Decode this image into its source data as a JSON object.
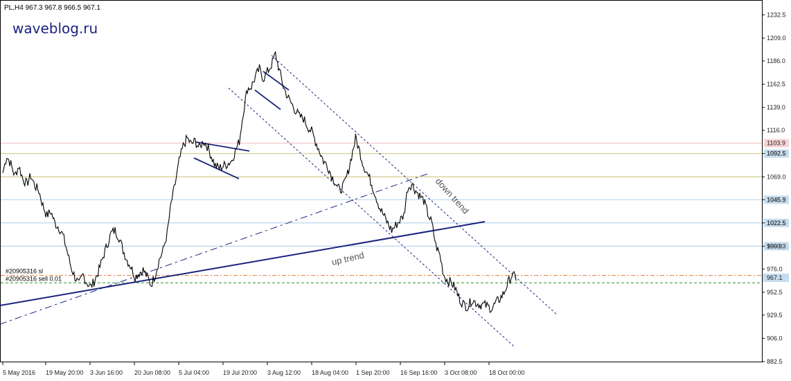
{
  "header": {
    "symbol_line": "PL,H4  967.3 967.8 966.5 967.1",
    "brand": "waveblog.ru"
  },
  "colors": {
    "price": "#000000",
    "trendline": "#1a237e",
    "level_blue": "#b8d6ee",
    "level_olive": "#d2cc8c",
    "level_pink": "#f4c9c9",
    "sl_line": "#e8742a",
    "sell_line": "#2a8a2a",
    "axis_bg_blue": "#c6dcef"
  },
  "chart_data": {
    "type": "line",
    "title": "",
    "ylim": [
      882.5,
      1244
    ],
    "y_ticks": [
      "1232.5",
      "1209.0",
      "1186.0",
      "1162.5",
      "1139.0",
      "1116.0",
      "1092.5",
      "1069.0",
      "1045.9",
      "1022.5",
      "999.0",
      "976.0",
      "952.5",
      "929.5",
      "906.0",
      "882.5"
    ],
    "x_ticks": [
      "5 May 2016",
      "19 May 20:00",
      "3 Jun 16:00",
      "20 Jun 08:00",
      "5 Jul 04:00",
      "19 Jul 20:00",
      "3 Aug 12:00",
      "18 Aug 04:00",
      "1 Sep 20:00",
      "16 Sep 16:00",
      "3 Oct 08:00",
      "18 Oct 00:00"
    ],
    "series": [
      {
        "values": [
          1073,
          1090,
          1082,
          1070,
          1080,
          1067,
          1062,
          1070,
          1060,
          1055,
          1040,
          1030,
          1034,
          1022,
          1018,
          1010,
          995,
          978,
          968,
          960,
          970,
          962,
          958,
          965,
          975,
          988,
          1000,
          1012,
          1015,
          1008,
          995,
          985,
          978,
          968,
          972,
          975,
          968,
          960,
          970,
          985,
          995,
          1012,
          1042,
          1062,
          1085,
          1100,
          1108,
          1102,
          1105,
          1098,
          1105,
          1100,
          1090,
          1080,
          1078,
          1080,
          1082,
          1085,
          1095,
          1105,
          1135,
          1158,
          1160,
          1170,
          1178,
          1168,
          1175,
          1182,
          1193,
          1176,
          1160,
          1150,
          1143,
          1136,
          1130,
          1128,
          1120,
          1115,
          1105,
          1095,
          1085,
          1080,
          1070,
          1063,
          1055,
          1060,
          1072,
          1090,
          1108,
          1095,
          1080,
          1072,
          1062,
          1050,
          1038,
          1030,
          1022,
          1015,
          1020,
          1025,
          1030,
          1058,
          1062,
          1055,
          1050,
          1045,
          1032,
          1022,
          1000,
          990,
          970,
          964,
          962,
          955,
          945,
          940,
          938,
          945,
          942,
          940,
          940,
          938,
          936,
          942,
          946,
          952,
          962,
          970,
          967
        ]
      }
    ],
    "levels": [
      {
        "value": 1103,
        "kind": "pink",
        "label": "1103.9"
      },
      {
        "value": 1092.5,
        "kind": "olive",
        "label": "1092.5"
      },
      {
        "value": 1069.0,
        "kind": "olive",
        "label": ""
      },
      {
        "value": 1045.9,
        "kind": "blue",
        "label": "1045.9"
      },
      {
        "value": 1022.5,
        "kind": "blue",
        "label": "1022.5"
      },
      {
        "value": 999.0,
        "kind": "blue",
        "label": "1000.3"
      }
    ],
    "orders": [
      {
        "value": 969.5,
        "label": "#20905316 sl",
        "kind": "sl"
      },
      {
        "value": 962.0,
        "label": "#20905316 sell 0.01",
        "kind": "sell"
      }
    ],
    "current_price": "967.1",
    "annotations": [
      {
        "text": "up trend"
      },
      {
        "text": "down trend"
      }
    ]
  }
}
